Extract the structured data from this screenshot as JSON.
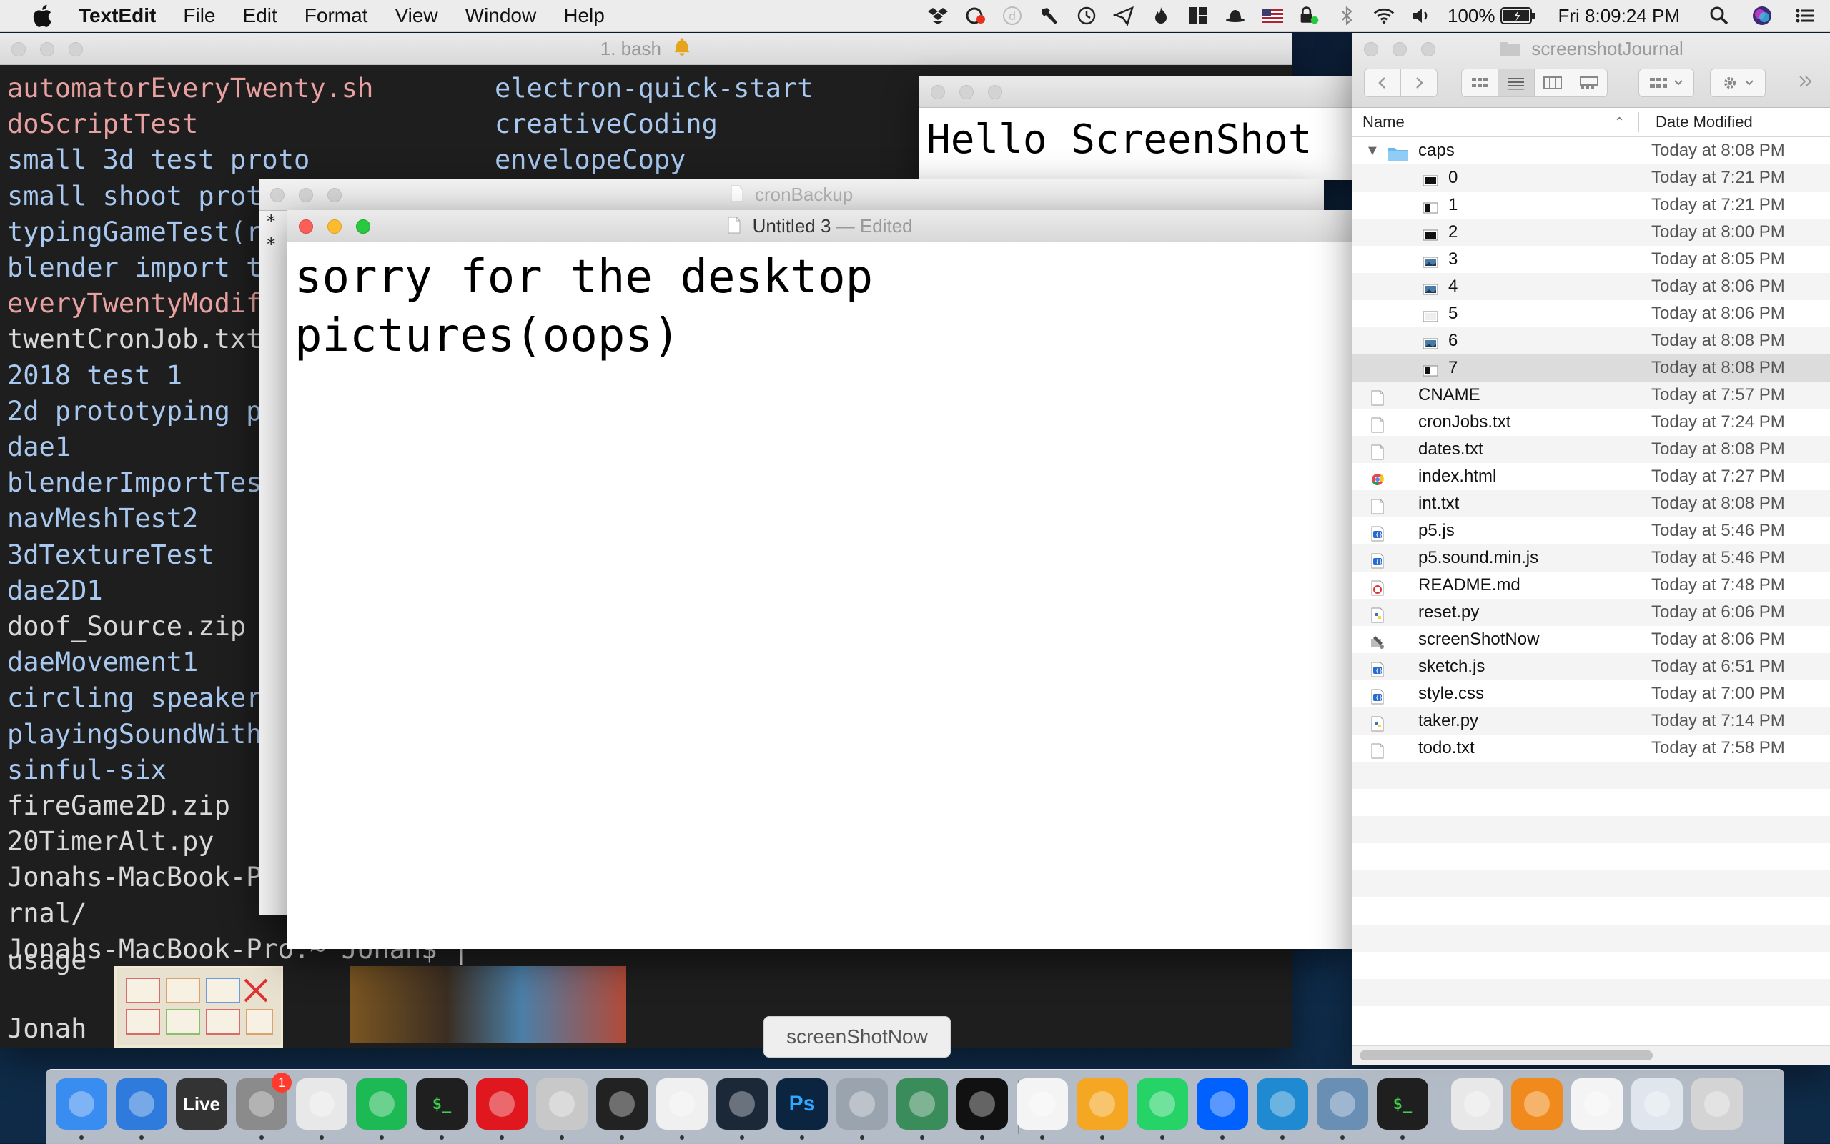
{
  "menubar": {
    "app_name": "TextEdit",
    "items": [
      "File",
      "Edit",
      "Format",
      "View",
      "Window",
      "Help"
    ],
    "battery": "100%",
    "clock": "Fri 8:09:24 PM"
  },
  "terminal": {
    "title": "1. bash",
    "col1": [
      {
        "text": "automatorEveryTwenty.sh",
        "color": "pink"
      },
      {
        "text": "doScriptTest",
        "color": "pink"
      },
      {
        "text": "small 3d test proto",
        "color": "blue"
      },
      {
        "text": "small shoot prot",
        "color": "blue"
      },
      {
        "text": "typingGameTest(r",
        "color": "blue"
      },
      {
        "text": "blender import t",
        "color": "blue"
      },
      {
        "text": "everyTwentyModif",
        "color": "pink"
      },
      {
        "text": "twentCronJob.txt",
        "color": "white"
      },
      {
        "text": "2018 test 1",
        "color": "blue"
      },
      {
        "text": "2d prototyping p",
        "color": "blue"
      },
      {
        "text": "dae1",
        "color": "blue"
      },
      {
        "text": "blenderImportTes",
        "color": "blue"
      },
      {
        "text": "navMeshTest2",
        "color": "blue"
      },
      {
        "text": "3dTextureTest",
        "color": "blue"
      },
      {
        "text": "dae2D1",
        "color": "blue"
      },
      {
        "text": "doof_Source.zip",
        "color": "white"
      },
      {
        "text": "daeMovement1",
        "color": "blue"
      },
      {
        "text": "circling speaker",
        "color": "blue"
      },
      {
        "text": "playingSoundWith",
        "color": "blue"
      },
      {
        "text": "sinful-six",
        "color": "blue"
      },
      {
        "text": "fireGame2D.zip",
        "color": "white"
      },
      {
        "text": "20TimerAlt.py",
        "color": "white"
      },
      {
        "text": "Jonahs-MacBook-P",
        "color": "white"
      },
      {
        "text": "rnal/",
        "color": "white"
      },
      {
        "text": "Jonahs-MacBook-Pro:~ Jonah$ |",
        "color": "white"
      }
    ],
    "col2": [
      {
        "text": "electron-quick-start",
        "color": "blue"
      },
      {
        "text": "creativeCoding",
        "color": "blue"
      },
      {
        "text": "envelopeCopy",
        "color": "blue"
      }
    ],
    "trailing": [
      "usage",
      "Jonah"
    ]
  },
  "hello_window": {
    "text": "Hello ScreenShot"
  },
  "cron_window": {
    "title": "cronBackup",
    "stars": [
      "*",
      "*"
    ]
  },
  "textedit": {
    "title": "Untitled 3",
    "edited": "— Edited",
    "line1": "sorry for the desktop",
    "line2": "pictures(oops)"
  },
  "finder": {
    "title": "screenshotJournal",
    "col_name": "Name",
    "col_date": "Date Modified",
    "rows": [
      {
        "name": "caps",
        "date": "Today at 8:08 PM",
        "kind": "folder",
        "level": 0,
        "expanded": true
      },
      {
        "name": "0",
        "date": "Today at 7:21 PM",
        "kind": "img-dark",
        "level": 1
      },
      {
        "name": "1",
        "date": "Today at 7:21 PM",
        "kind": "img-split",
        "level": 1
      },
      {
        "name": "2",
        "date": "Today at 8:00 PM",
        "kind": "img-dark",
        "level": 1
      },
      {
        "name": "3",
        "date": "Today at 8:05 PM",
        "kind": "img-photo",
        "level": 1
      },
      {
        "name": "4",
        "date": "Today at 8:06 PM",
        "kind": "img-photo",
        "level": 1
      },
      {
        "name": "5",
        "date": "Today at 8:06 PM",
        "kind": "img-light",
        "level": 1
      },
      {
        "name": "6",
        "date": "Today at 8:08 PM",
        "kind": "img-photo",
        "level": 1
      },
      {
        "name": "7",
        "date": "Today at 8:08 PM",
        "kind": "img-split",
        "level": 1,
        "selected": true
      },
      {
        "name": "CNAME",
        "date": "Today at 7:57 PM",
        "kind": "doc",
        "level": 0
      },
      {
        "name": "cronJobs.txt",
        "date": "Today at 7:24 PM",
        "kind": "doc",
        "level": 0
      },
      {
        "name": "dates.txt",
        "date": "Today at 8:08 PM",
        "kind": "doc",
        "level": 0
      },
      {
        "name": "index.html",
        "date": "Today at 7:27 PM",
        "kind": "chrome",
        "level": 0
      },
      {
        "name": "int.txt",
        "date": "Today at 8:08 PM",
        "kind": "doc",
        "level": 0
      },
      {
        "name": "p5.js",
        "date": "Today at 5:46 PM",
        "kind": "code",
        "level": 0
      },
      {
        "name": "p5.sound.min.js",
        "date": "Today at 5:46 PM",
        "kind": "code",
        "level": 0
      },
      {
        "name": "README.md",
        "date": "Today at 7:48 PM",
        "kind": "md",
        "level": 0
      },
      {
        "name": "reset.py",
        "date": "Today at 6:06 PM",
        "kind": "py",
        "level": 0
      },
      {
        "name": "screenShotNow",
        "date": "Today at 8:06 PM",
        "kind": "exec",
        "level": 0
      },
      {
        "name": "sketch.js",
        "date": "Today at 6:51 PM",
        "kind": "code",
        "level": 0
      },
      {
        "name": "style.css",
        "date": "Today at 7:00 PM",
        "kind": "code",
        "level": 0
      },
      {
        "name": "taker.py",
        "date": "Today at 7:14 PM",
        "kind": "py",
        "level": 0
      },
      {
        "name": "todo.txt",
        "date": "Today at 7:58 PM",
        "kind": "doc",
        "level": 0
      }
    ]
  },
  "dock": {
    "tooltip": "screenShotNow",
    "live_label": "Live",
    "settings_badge": "1",
    "ps_label": "Ps",
    "items": [
      {
        "name": "finder",
        "color": "#3a8df0"
      },
      {
        "name": "safari",
        "color": "#2f7bdd"
      },
      {
        "name": "ableton-live",
        "color": "#333333"
      },
      {
        "name": "system-preferences",
        "color": "#8b8b8b"
      },
      {
        "name": "chrome",
        "color": "#e8e8e8"
      },
      {
        "name": "spotify",
        "color": "#1db954"
      },
      {
        "name": "terminal",
        "color": "#1f1f1f"
      },
      {
        "name": "opera",
        "color": "#e0171f"
      },
      {
        "name": "script-editor",
        "color": "#c8c8c8"
      },
      {
        "name": "activity-monitor",
        "color": "#222222"
      },
      {
        "name": "unity",
        "color": "#f0f0f0"
      },
      {
        "name": "steam",
        "color": "#1b2838"
      },
      {
        "name": "photoshop",
        "color": "#0b2540"
      },
      {
        "name": "automator",
        "color": "#9aa4ae"
      },
      {
        "name": "sublime-merge",
        "color": "#3a8d5a"
      },
      {
        "name": "textedit-doc",
        "color": "#111111"
      },
      {
        "name": "textedit",
        "color": "#f4f4f4"
      },
      {
        "name": "xcode-hammer",
        "color": "#f5a623"
      },
      {
        "name": "whatsapp",
        "color": "#25d366"
      },
      {
        "name": "dropbox",
        "color": "#0061fe"
      },
      {
        "name": "vscode",
        "color": "#1f8ad2"
      },
      {
        "name": "preview",
        "color": "#6a8fb5"
      },
      {
        "name": "terminal-2",
        "color": "#1f1f1f"
      },
      {
        "name": "pdf-doc",
        "color": "#e8e8e8"
      },
      {
        "name": "vlc",
        "color": "#f08a1c"
      },
      {
        "name": "txt-doc",
        "color": "#f4f4f4"
      },
      {
        "name": "document-stack",
        "color": "#dfe6ee"
      },
      {
        "name": "trash",
        "color": "#d4d4d4"
      }
    ]
  }
}
